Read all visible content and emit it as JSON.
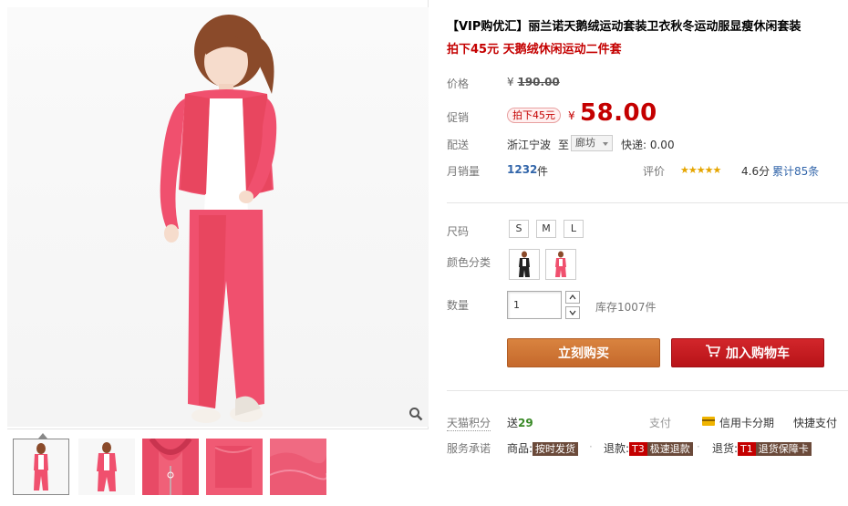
{
  "product": {
    "title": "【VIP购优汇】丽兰诺天鹅绒运动套装卫衣秋冬运动服显瘦休闲套装",
    "subtitle": "拍下45元 天鹅绒休闲运动二件套"
  },
  "price": {
    "label": "价格",
    "currency": "¥",
    "original": "190.00"
  },
  "promo": {
    "label": "促销",
    "tag": "拍下45元",
    "currency": "¥",
    "price": "58.00"
  },
  "delivery": {
    "label": "配送",
    "from": "浙江宁波",
    "to_word": "至",
    "to_city": "廊坊",
    "shipping": "快递: 0.00"
  },
  "sales": {
    "label": "月销量",
    "count": "1232",
    "unit": "件",
    "rating_label": "评价",
    "stars": "★★★★★",
    "score": "4.6分",
    "reviews": "累计85条"
  },
  "size": {
    "label": "尺码",
    "options": [
      "S",
      "M",
      "L"
    ]
  },
  "color": {
    "label": "颜色分类"
  },
  "quantity": {
    "label": "数量",
    "value": "1",
    "stock": "库存1007件"
  },
  "actions": {
    "buy_now": "立刻购买",
    "add_to_cart": "加入购物车"
  },
  "points": {
    "label": "天猫积分",
    "prefix": "送",
    "value": "29",
    "pay_label": "支付",
    "installment": "信用卡分期",
    "quick_pay": "快捷支付"
  },
  "service": {
    "label": "服务承诺",
    "item1_prefix": "商品:",
    "item1_badge": "按时发货",
    "item2_prefix": "退款:",
    "item2_code": "T3",
    "item2_badge": "极速退款",
    "item3_prefix": "退货:",
    "item3_code": "T1",
    "item3_badge": "退货保障卡"
  },
  "colors": {
    "price_red": "#c40000",
    "buy_orange": "#d07a38",
    "cart_red": "#c41c21",
    "link_blue": "#3366aa",
    "product_pink": "#f0506e"
  }
}
